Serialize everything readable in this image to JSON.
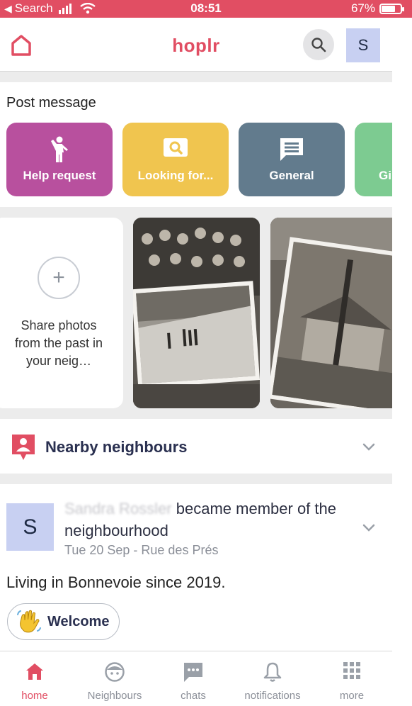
{
  "status_bar": {
    "back_app": "Search",
    "time": "08:51",
    "battery": "67%",
    "battery_level": 0.67
  },
  "header": {
    "brand": "hoplr",
    "avatar_initial": "S"
  },
  "post_message": {
    "title": "Post message",
    "tiles": [
      {
        "label": "Help request",
        "color": "#b8509e",
        "icon": "person-waving-icon"
      },
      {
        "label": "Looking for...",
        "color": "#f0c54f",
        "icon": "search-box-icon"
      },
      {
        "label": "General",
        "color": "#627b8d",
        "icon": "chat-icon"
      },
      {
        "label": "Gi",
        "color": "#7dcb91",
        "icon": "gift-icon"
      }
    ]
  },
  "photos": {
    "share_text": "Share photos from the past in your neig…"
  },
  "nearby": {
    "title": "Nearby neighbours"
  },
  "feed": {
    "avatar_initial": "S",
    "name_hidden": "Sandra Rossler",
    "action": "became member of the neighbourhood",
    "meta": "Tue 20 Sep - Rue des Prés",
    "body": "Living in Bonnevoie since 2019.",
    "welcome_label": "Welcome"
  },
  "nav": [
    {
      "label": "home",
      "icon": "home-icon",
      "active": true
    },
    {
      "label": "Neighbours",
      "icon": "neighbour-face-icon"
    },
    {
      "label": "chats",
      "icon": "chat-bubble-icon"
    },
    {
      "label": "notifications",
      "icon": "bell-icon"
    },
    {
      "label": "more",
      "icon": "grid-icon"
    }
  ],
  "colors": {
    "brand": "#e14e63",
    "navy": "#2a3050",
    "avatar_bg": "#c8d0f2"
  }
}
